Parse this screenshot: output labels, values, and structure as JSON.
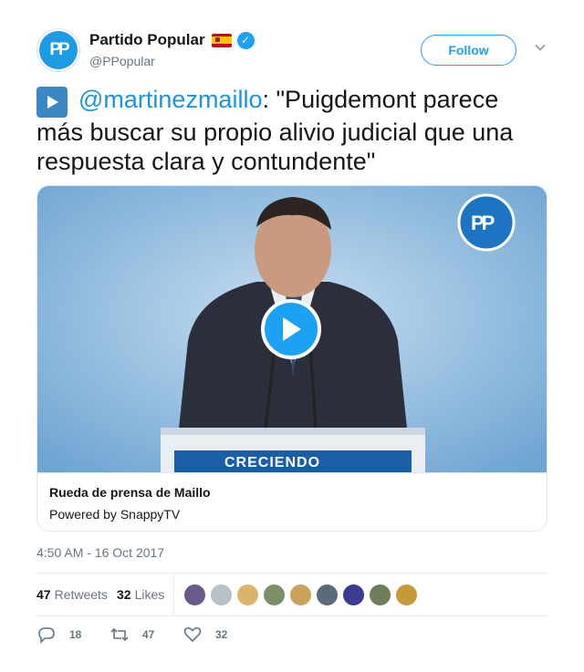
{
  "account": {
    "display_name": "Partido Popular",
    "handle": "@PPopular",
    "avatar_text": "PP",
    "follow_label": "Follow"
  },
  "tweet": {
    "mention": "@martinezmaillo",
    "text": ": \"Puigdemont parece más buscar su propio alivio judicial que una respuesta clara y contundente\""
  },
  "card": {
    "video_overlay_logo": "PP",
    "video_overlay_banner": "CRECIENDO",
    "title": "Rueda de prensa de Maillo",
    "source": "Powered by SnappyTV"
  },
  "timestamp": "4:50 AM - 16 Oct 2017",
  "stats": {
    "retweets_count": "47",
    "retweets_label": "Retweets",
    "likes_count": "32",
    "likes_label": "Likes"
  },
  "likers_colors": [
    "#6b5a8c",
    "#b8c0c8",
    "#d9b46a",
    "#7d8f6a",
    "#c9a35a",
    "#5b6b7a",
    "#3b3b8f",
    "#6f7d5a",
    "#c59a3a"
  ],
  "actions": {
    "reply_count": "18",
    "retweet_count": "47",
    "like_count": "32"
  },
  "colors": {
    "accent": "#1da1f2",
    "mention": "#1b95e0",
    "muted": "#657786"
  },
  "icons": [
    "verified-badge-icon",
    "spain-flag-icon",
    "chevron-down-icon",
    "play-emoji-icon",
    "play-icon",
    "reply-icon",
    "retweet-icon",
    "heart-icon"
  ]
}
